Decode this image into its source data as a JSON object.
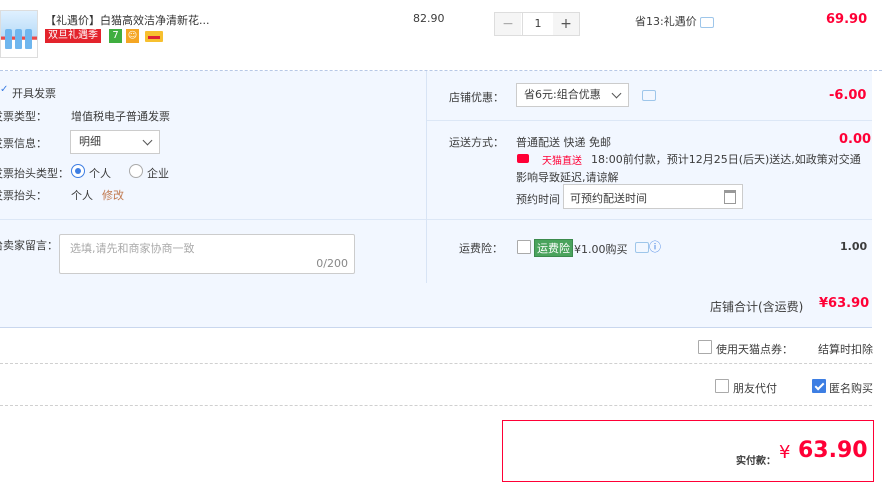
{
  "item": {
    "title": "【礼遇价】白猫高效洁净清新花...",
    "unit_price": "82.90",
    "quantity": "1",
    "minus_symbol": "−",
    "plus_symbol": "+",
    "promo_note": "省13:礼遇价",
    "subtotal": "69.90",
    "tags": {
      "sale": "双旦礼遇季",
      "seven": "7",
      "badge2": "券"
    }
  },
  "invoice": {
    "enable_label": "开具发票",
    "type_label": "发票类型：",
    "type_value": "增值税电子普通发票",
    "info_label": "发票信息：",
    "info_value": "明细",
    "title_type_label": "发票抬头类型：",
    "title_type_options": [
      "个人",
      "企业"
    ],
    "title_label": "发票抬头：",
    "title_value": "个人",
    "edit_link": "修改"
  },
  "message": {
    "label": "给卖家留言：",
    "placeholder": "选填,请先和商家协商一致",
    "counter": "0/200"
  },
  "store_discount": {
    "label": "店铺优惠：",
    "selected": "省6元:组合优惠",
    "amount": "-6.00"
  },
  "shipping": {
    "label": "运送方式：",
    "method": "普通配送 快递 免邮",
    "amount": "0.00",
    "brand": "天猫直送",
    "notice_line1": "18:00前付款，预计12月25日(后天)送达,如政策对交通",
    "notice_line2": "影响导致延迟,请谅解",
    "appt_label": "预约时间",
    "appt_placeholder": "可预约配送时间"
  },
  "insurance": {
    "label": "运费险：",
    "badge": "运费险",
    "price_text": "¥1.00购买",
    "amount": "1.00"
  },
  "store_total": {
    "label": "店铺合计(含运费)",
    "value": "¥63.90"
  },
  "points": {
    "label": "使用天猫点券：",
    "note": "结算时扣除"
  },
  "options": {
    "friend_pay": "朋友代付",
    "anonymous": "匿名购买"
  },
  "payment": {
    "label": "实付款：",
    "currency": "¥",
    "value": "63.90"
  },
  "colors": {
    "accent_red": "#ff0036",
    "accent_blue": "#3d7ee3",
    "panel_bg": "#f2f7ff"
  }
}
